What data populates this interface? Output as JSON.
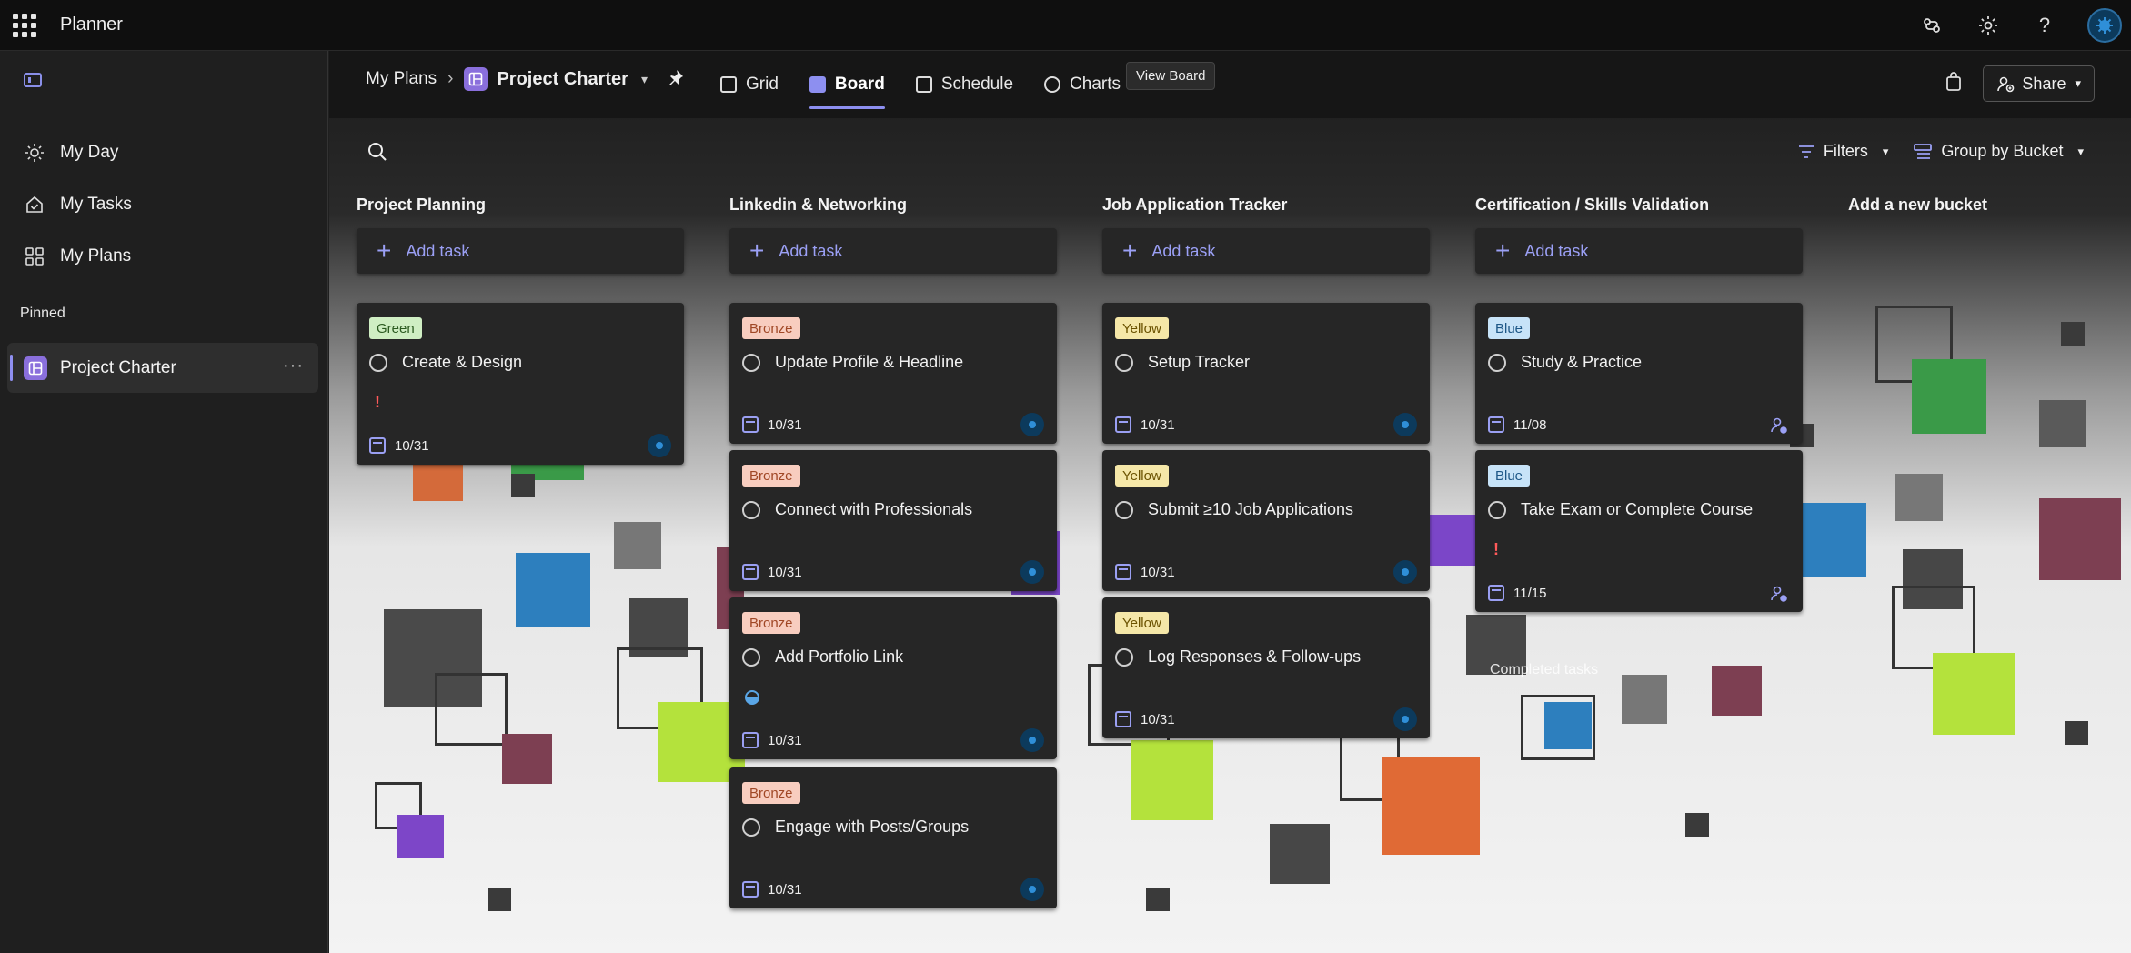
{
  "app": {
    "title": "Planner"
  },
  "sidebar": {
    "items": [
      {
        "label": "My Day",
        "icon": "sun-icon"
      },
      {
        "label": "My Tasks",
        "icon": "tasks-icon"
      },
      {
        "label": "My Plans",
        "icon": "plans-icon"
      }
    ],
    "pinned_label": "Pinned",
    "pinned_plan": "Project Charter"
  },
  "header": {
    "breadcrumb_root": "My Plans",
    "plan_name": "Project Charter",
    "views": [
      "Grid",
      "Board",
      "Schedule",
      "Charts"
    ],
    "active_view": "Board",
    "tooltip": "View Board",
    "share_label": "Share"
  },
  "toolbar": {
    "filters_label": "Filters",
    "group_label": "Group by Bucket"
  },
  "buckets": [
    {
      "title": "Project Planning",
      "add_task": "Add task",
      "tasks": [
        {
          "label": "Green",
          "label_color": "green",
          "title": "Create & Design",
          "date": "10/31",
          "priority": "!"
        }
      ]
    },
    {
      "title": "Linkedin & Networking",
      "add_task": "Add task",
      "tasks": [
        {
          "label": "Bronze",
          "label_color": "bronze",
          "title": "Update Profile & Headline",
          "date": "10/31"
        },
        {
          "label": "Bronze",
          "label_color": "bronze",
          "title": "Connect with Professionals",
          "date": "10/31"
        },
        {
          "label": "Bronze",
          "label_color": "bronze",
          "title": "Add Portfolio Link",
          "date": "10/31",
          "progress": "in-progress"
        },
        {
          "label": "Bronze",
          "label_color": "bronze",
          "title": "Engage with Posts/Groups",
          "date": "10/31"
        }
      ]
    },
    {
      "title": "Job Application Tracker",
      "add_task": "Add task",
      "tasks": [
        {
          "label": "Yellow",
          "label_color": "yellow",
          "title": "Setup Tracker",
          "date": "10/31"
        },
        {
          "label": "Yellow",
          "label_color": "yellow",
          "title": "Submit ≥10 Job Applications",
          "date": "10/31"
        },
        {
          "label": "Yellow",
          "label_color": "yellow",
          "title": "Log Responses & Follow-ups",
          "date": "10/31"
        }
      ]
    },
    {
      "title": "Certification / Skills Validation",
      "add_task": "Add task",
      "tasks": [
        {
          "label": "Blue",
          "label_color": "blue",
          "title": "Study & Practice",
          "date": "11/08"
        },
        {
          "label": "Blue",
          "label_color": "blue",
          "title": "Take Exam or Complete Course",
          "date": "11/15",
          "priority": "!"
        }
      ]
    }
  ],
  "new_bucket_label": "Add a new bucket",
  "background_fragment": "Completed tasks",
  "colors": {
    "accent": "#8d8ff0",
    "green_chip": "#cfeec3",
    "bronze_chip": "#f8cdbf",
    "yellow_chip": "#f5e7a8",
    "blue_chip": "#c7e3f8",
    "card_bg": "#262626"
  }
}
